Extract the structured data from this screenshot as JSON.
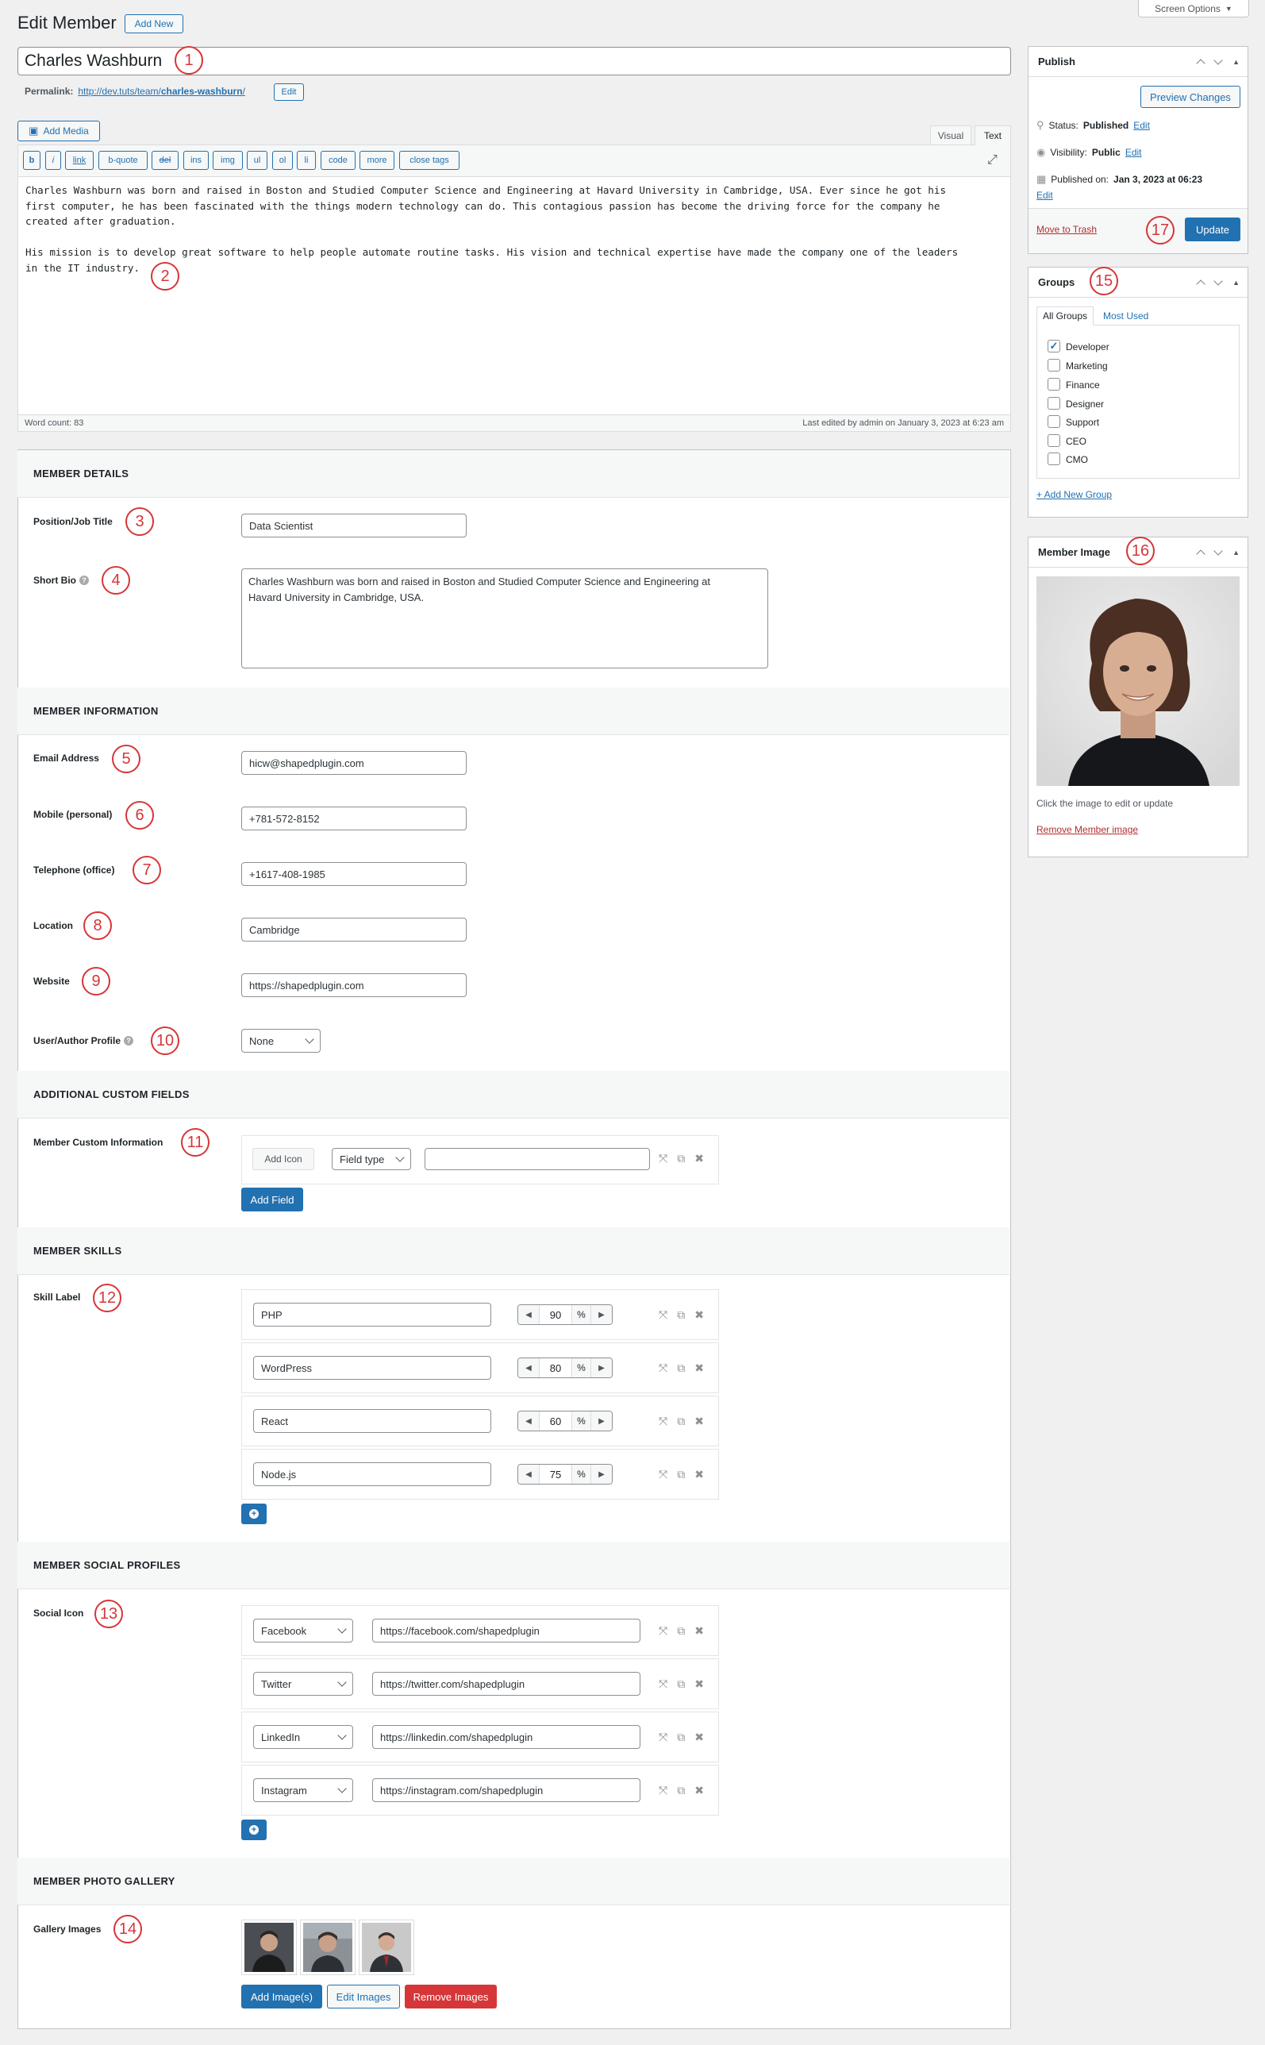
{
  "header": {
    "title": "Edit Member",
    "add_new": "Add New",
    "screen_options": "Screen Options"
  },
  "post": {
    "title": "Charles Washburn",
    "permalink_label": "Permalink:",
    "permalink_base": "http://dev.tuts/team/",
    "permalink_slug": "charles-washburn",
    "permalink_end": "/",
    "permalink_edit": "Edit"
  },
  "editor": {
    "add_media": "Add Media",
    "tab_visual": "Visual",
    "tab_text": "Text",
    "buttons": [
      "b",
      "i",
      "link",
      "b-quote",
      "del",
      "ins",
      "img",
      "ul",
      "ol",
      "li",
      "code",
      "more",
      "close tags"
    ],
    "para1_line1": "Charles Washburn was born and raised in Boston and Studied Computer Science and Engineering at Havard University in Cambridge, USA. Ever since he got his",
    "para1_line2": "first computer, he has been fascinated with the things modern technology can do. This contagious passion has become the driving force for the company he",
    "para1_line3": "created after graduation.",
    "para2_line1": "His mission is to develop great software to help people automate routine tasks. His vision and technical expertise have made the company one of the leaders",
    "para2_line2": "in the IT industry.",
    "word_count": "Word count: 83",
    "last_edited": "Last edited by admin on January 3, 2023 at 6:23 am"
  },
  "member_details": {
    "heading": "MEMBER DETAILS",
    "position_label": "Position/Job Title",
    "position_value": "Data Scientist",
    "bio_label": "Short Bio",
    "bio_line1": "Charles Washburn was born and raised in Boston and Studied Computer Science and Engineering at",
    "bio_line2": "Havard University in Cambridge, USA."
  },
  "member_info": {
    "heading": "MEMBER INFORMATION",
    "email_label": "Email Address",
    "email_value": "hicw@shapedplugin.com",
    "mobile_label": "Mobile (personal)",
    "mobile_value": "+781-572-8152",
    "phone_label": "Telephone (office)",
    "phone_value": "+1617-408-1985",
    "location_label": "Location",
    "location_value": "Cambridge",
    "website_label": "Website",
    "website_value": "https://shapedplugin.com",
    "profile_label": "User/Author Profile",
    "profile_value": "None"
  },
  "custom_fields": {
    "heading": "ADDITIONAL CUSTOM FIELDS",
    "label": "Member Custom Information",
    "add_icon": "Add Icon",
    "field_type": "Field type",
    "add_field": "Add Field"
  },
  "skills": {
    "heading": "MEMBER SKILLS",
    "label": "Skill Label",
    "unit": "%",
    "items": [
      {
        "name": "PHP",
        "value": "90"
      },
      {
        "name": "WordPress",
        "value": "80"
      },
      {
        "name": "React",
        "value": "60"
      },
      {
        "name": "Node.js",
        "value": "75"
      }
    ]
  },
  "social": {
    "heading": "MEMBER SOCIAL PROFILES",
    "label": "Social Icon",
    "items": [
      {
        "network": "Facebook",
        "url": "https://facebook.com/shapedplugin"
      },
      {
        "network": "Twitter",
        "url": "https://twitter.com/shapedplugin"
      },
      {
        "network": "LinkedIn",
        "url": "https://linkedin.com/shapedplugin"
      },
      {
        "network": "Instagram",
        "url": "https://instagram.com/shapedplugin"
      }
    ]
  },
  "gallery": {
    "heading": "MEMBER PHOTO GALLERY",
    "label": "Gallery Images",
    "add": "Add Image(s)",
    "edit": "Edit Images",
    "remove": "Remove Images"
  },
  "publish": {
    "title": "Publish",
    "preview": "Preview Changes",
    "status_label": "Status:",
    "status_value": "Published",
    "status_edit": "Edit",
    "visibility_label": "Visibility:",
    "visibility_value": "Public",
    "visibility_edit": "Edit",
    "published_label": "Published on:",
    "published_value": "Jan 3, 2023 at 06:23",
    "published_edit": "Edit",
    "trash": "Move to Trash",
    "update": "Update"
  },
  "groups": {
    "title": "Groups",
    "tab_all": "All Groups",
    "tab_most": "Most Used",
    "items": [
      {
        "name": "Developer",
        "checked": true
      },
      {
        "name": "Marketing",
        "checked": false
      },
      {
        "name": "Finance",
        "checked": false
      },
      {
        "name": "Designer",
        "checked": false
      },
      {
        "name": "Support",
        "checked": false
      },
      {
        "name": "CEO",
        "checked": false
      },
      {
        "name": "CMO",
        "checked": false
      }
    ],
    "add_new": "+ Add New Group"
  },
  "member_image": {
    "title": "Member Image",
    "hint": "Click the image to edit or update",
    "remove": "Remove Member image"
  },
  "markers": [
    "1",
    "2",
    "3",
    "4",
    "5",
    "6",
    "7",
    "8",
    "9",
    "10",
    "11",
    "12",
    "13",
    "14",
    "15",
    "16",
    "17"
  ],
  "colors": {
    "accent": "#2271b1",
    "danger": "#d63638",
    "marker": "#d63638"
  }
}
